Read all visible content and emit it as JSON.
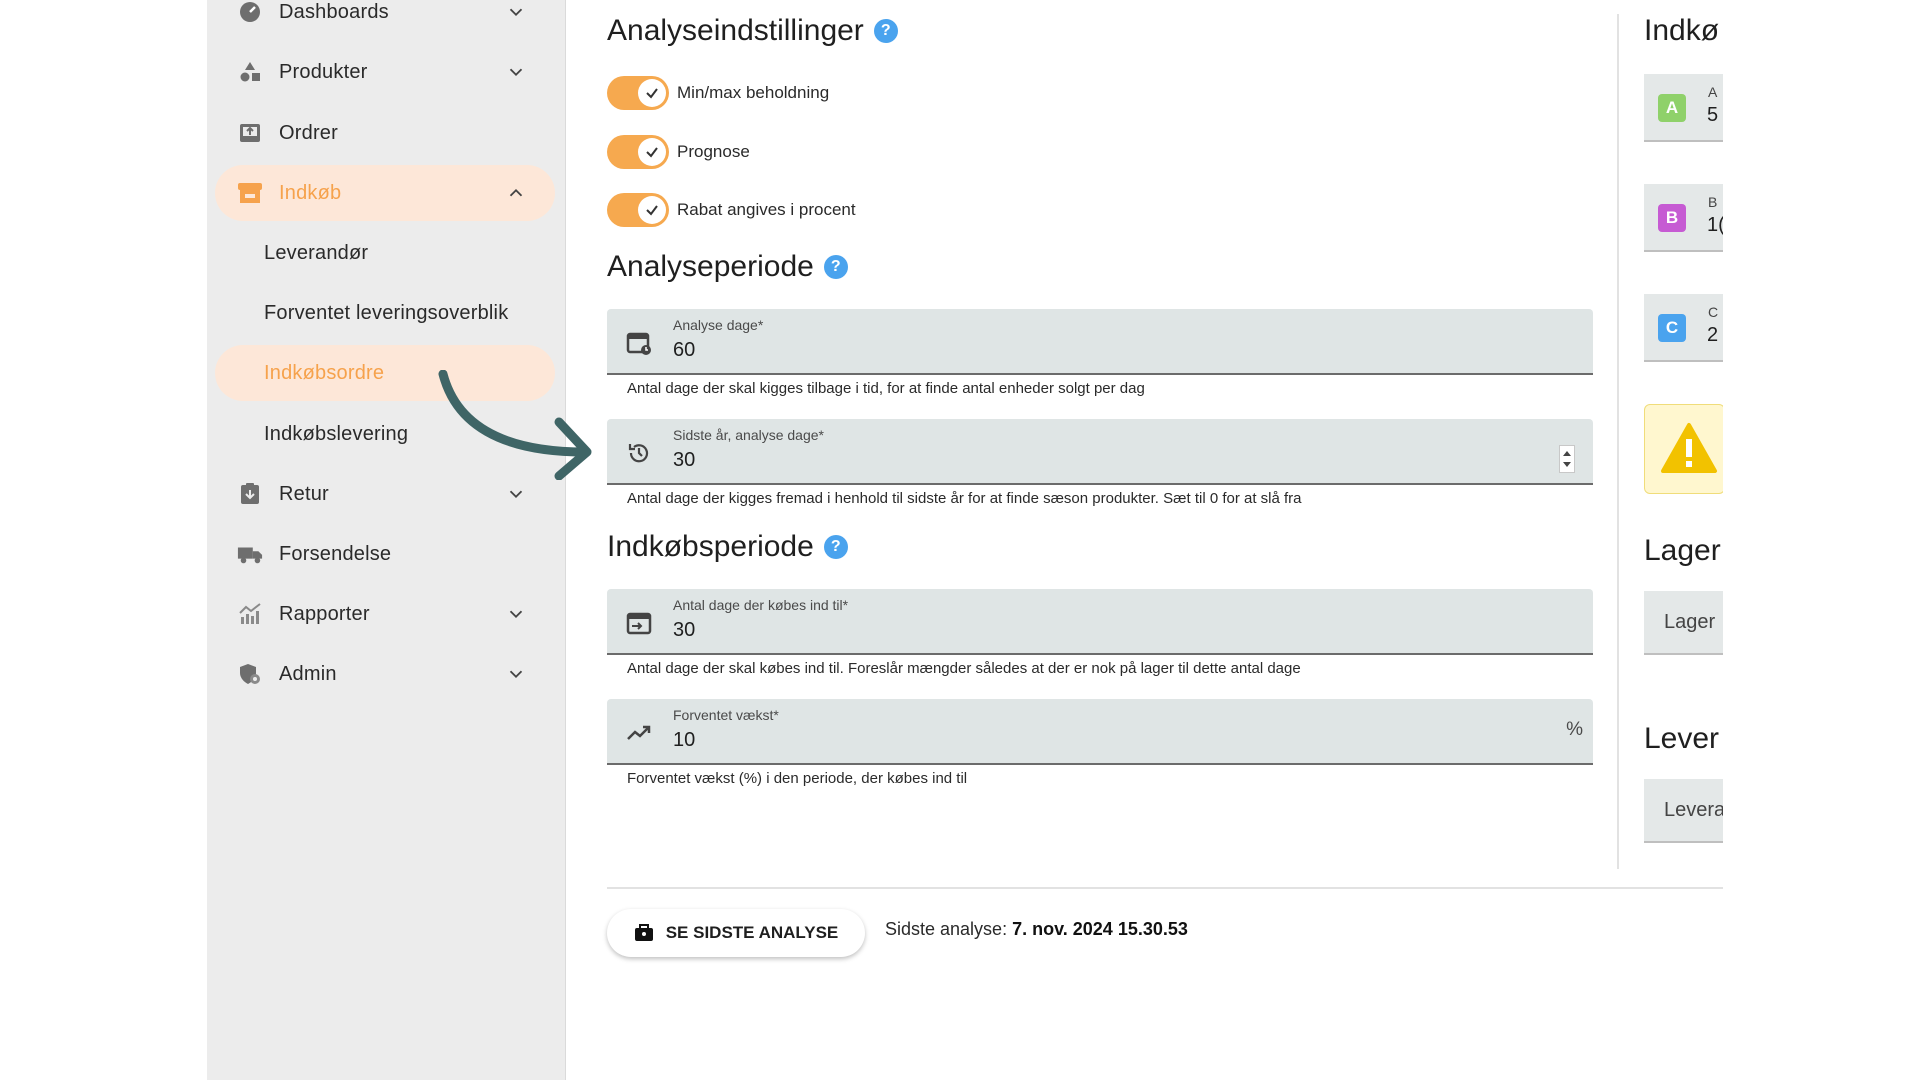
{
  "sidebar": {
    "items": [
      {
        "label": "Dashboards",
        "icon": "gauge-icon",
        "chevron": "down"
      },
      {
        "label": "Produkter",
        "icon": "shapes-icon",
        "chevron": "down"
      },
      {
        "label": "Ordrer",
        "icon": "inbox-upload-icon",
        "chevron": ""
      },
      {
        "label": "Indkøb",
        "icon": "store-icon",
        "chevron": "up"
      },
      {
        "label": "Leverandør"
      },
      {
        "label": "Forventet leveringsoverblik"
      },
      {
        "label": "Indkøbsordre"
      },
      {
        "label": "Indkøbslevering"
      },
      {
        "label": "Retur",
        "icon": "clipboard-return-icon",
        "chevron": "down"
      },
      {
        "label": "Forsendelse",
        "icon": "truck-icon",
        "chevron": ""
      },
      {
        "label": "Rapporter",
        "icon": "chart-icon",
        "chevron": "down"
      },
      {
        "label": "Admin",
        "icon": "admin-shield-icon",
        "chevron": "down"
      }
    ]
  },
  "analysis_settings": {
    "title": "Analyseindstillinger",
    "toggles": [
      {
        "label": "Min/max beholdning",
        "checked": true
      },
      {
        "label": "Prognose",
        "checked": true
      },
      {
        "label": "Rabat angives i procent",
        "checked": true
      }
    ]
  },
  "analysis_period": {
    "title": "Analyseperiode",
    "fields": [
      {
        "label": "Analyse dage*",
        "value": "60",
        "hint": "Antal dage der skal kigges tilbage i tid, for at finde antal enheder solgt per dag"
      },
      {
        "label": "Sidste år, analyse dage*",
        "value": "30",
        "hint": "Antal dage der kigges fremad i henhold til sidste år for at finde sæson produkter. Sæt til 0 for at slå fra"
      }
    ]
  },
  "purchase_period": {
    "title": "Indkøbsperiode",
    "fields": [
      {
        "label": "Antal dage der købes ind til*",
        "value": "30",
        "hint": "Antal dage der skal købes ind til. Foreslår mængder således at der er nok på lager til dette antal dage"
      },
      {
        "label": "Forventet vækst*",
        "value": "10",
        "suffix": "%",
        "hint": "Forventet vækst (%) i den periode, der købes ind til"
      }
    ]
  },
  "footer": {
    "button_label": "SE SIDSTE ANALYSE",
    "last_label": "Sidste analyse:",
    "last_value": "7. nov. 2024 15.30.53"
  },
  "right_panel": {
    "title_purchase": "Indkø",
    "cards": [
      {
        "badge": "A",
        "color": "#8fd16a",
        "small": "A",
        "big": "5"
      },
      {
        "badge": "B",
        "color": "#c65bd3",
        "small": "B",
        "big": "1("
      },
      {
        "badge": "C",
        "color": "#4aa3ee",
        "small": "C",
        "big": "2"
      }
    ],
    "title_stock": "Lager",
    "stock_select": "Lager",
    "title_supplier": "Lever",
    "supplier_select": "Levera"
  },
  "colors": {
    "accent": "#f6a94f",
    "accent_bg": "#fde7d8",
    "help": "#4aa3ee"
  }
}
